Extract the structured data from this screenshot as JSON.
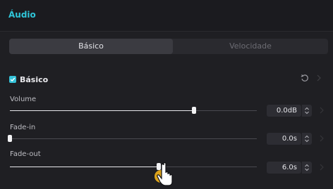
{
  "header": {
    "title": "Áudio"
  },
  "tabs": [
    {
      "label": "Básico",
      "active": true
    },
    {
      "label": "Velocidade",
      "active": false
    }
  ],
  "section": {
    "label": "Básico",
    "checked": true
  },
  "params": [
    {
      "label": "Volume",
      "value": "0.0dB",
      "level": 0.747
    },
    {
      "label": "Fade-in",
      "value": "0.0s",
      "level": 0.0
    },
    {
      "label": "Fade-out",
      "value": "6.0s",
      "level": 0.603
    }
  ],
  "colors": {
    "accent": "#2fc6d9",
    "background": "#1f1f23"
  },
  "icons": {
    "reset": "reset-icon",
    "stepper": "stepper-icon",
    "check": "check-icon",
    "cursor": "hand-cursor-icon"
  }
}
